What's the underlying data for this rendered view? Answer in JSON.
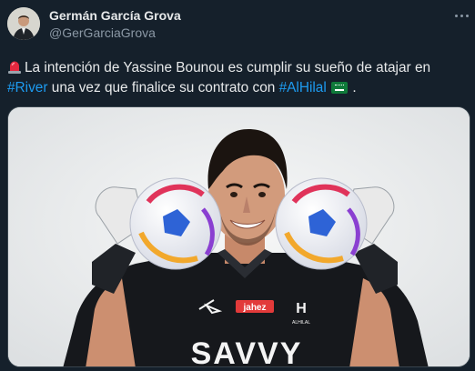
{
  "author": {
    "display_name": "Germán García Grova",
    "handle": "@GerGarciaGrova"
  },
  "icons": {
    "more": "more-horizontal-icon",
    "siren": "police-siren-icon",
    "flag": "saudi-arabia-flag-icon"
  },
  "tweet": {
    "text_part1": "La intención de Yassine Bounou es cumplir su sueño de atajar en",
    "hashtag_river": "#River",
    "text_part2": " una vez que finalice su contrato con ",
    "hashtag_alhilal": "#AlHilal",
    "text_end": "."
  },
  "photo": {
    "jersey_sponsor": "SAVVY",
    "badge": "jahez",
    "crest": "ALHILAL"
  },
  "colors": {
    "background": "#15202b",
    "hashtag": "#1d9bf0",
    "secondary_text": "#8b98a5",
    "primary_text": "#e7e9ea"
  }
}
